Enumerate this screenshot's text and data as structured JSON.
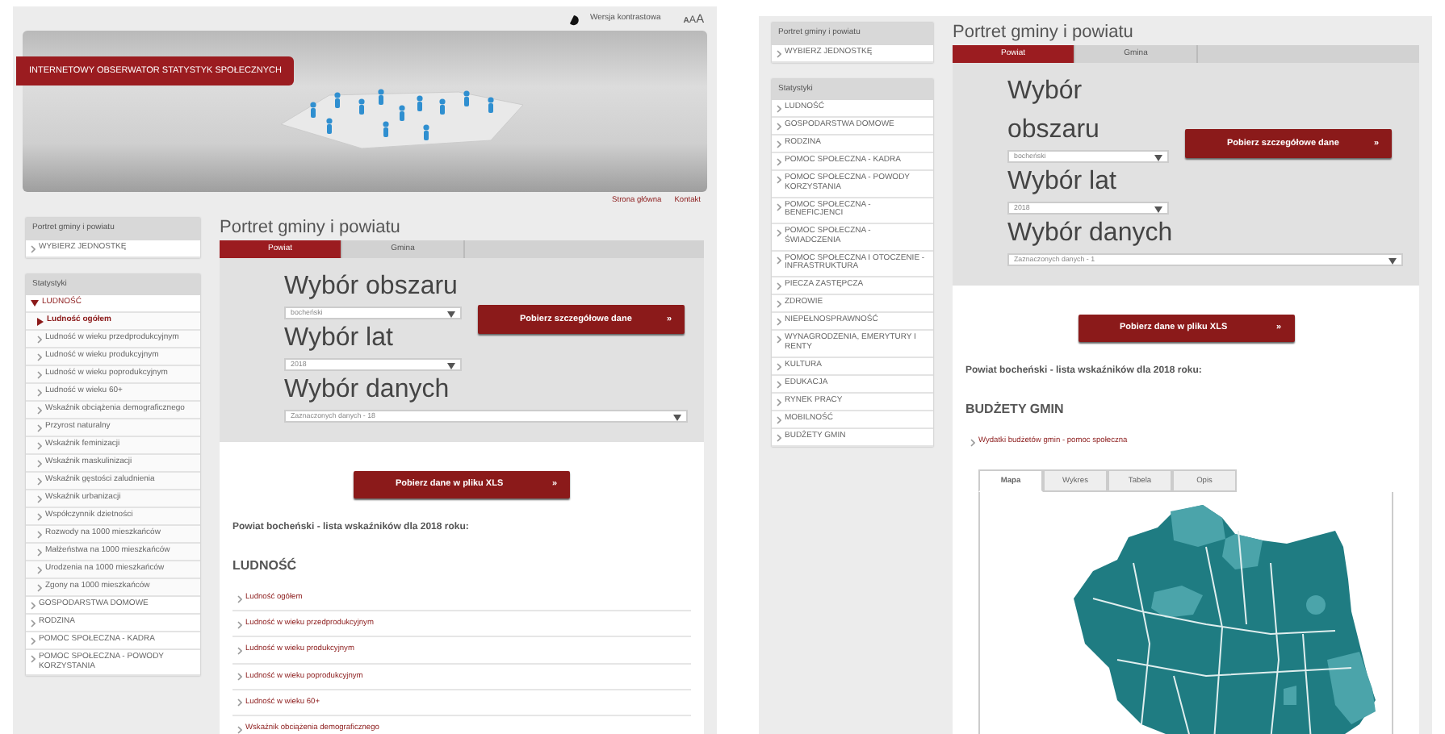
{
  "screens": [
    {
      "top_bar": {
        "contrast_link": "Wersja kontrastowa",
        "font_sizes": [
          "A",
          "A",
          "A"
        ]
      },
      "banner": {
        "title": "INTERNETOWY OBSERWATOR STATYSTYK SPOŁECZNYCH"
      },
      "top_links": [
        "Strona główna",
        "Kontakt"
      ],
      "sidebar": {
        "portrait_title": "Portret gminy i powiatu",
        "choose_unit": "WYBIERZ JEDNOSTKĘ",
        "stats_title": "Statystyki",
        "items": [
          {
            "label": "LUDNOŚĆ",
            "expanded": true,
            "children": [
              {
                "label": "Ludność ogółem",
                "selected": true
              },
              {
                "label": "Ludność w wieku przedprodukcyjnym",
                "selected": false
              },
              {
                "label": "Ludność w wieku produkcyjnym",
                "selected": false
              },
              {
                "label": "Ludność w wieku poprodukcyjnym",
                "selected": false
              },
              {
                "label": "Ludność w wieku 60+",
                "selected": false
              },
              {
                "label": "Wskaźnik obciążenia demograficznego",
                "selected": false
              },
              {
                "label": "Przyrost naturalny",
                "selected": false
              },
              {
                "label": "Wskaźnik feminizacji",
                "selected": false
              },
              {
                "label": "Wskaźnik maskulinizacji",
                "selected": false
              },
              {
                "label": "Wskaźnik gęstości zaludnienia",
                "selected": false
              },
              {
                "label": "Wskaźnik urbanizacji",
                "selected": false
              },
              {
                "label": "Współczynnik dzietności",
                "selected": false
              },
              {
                "label": "Rozwody na 1000 mieszkańców",
                "selected": false
              },
              {
                "label": "Małżeństwa na 1000 mieszkańców",
                "selected": false
              },
              {
                "label": "Urodzenia na 1000 mieszkańców",
                "selected": false
              },
              {
                "label": "Zgony na 1000 mieszkańców",
                "selected": false
              }
            ]
          },
          {
            "label": "GOSPODARSTWA DOMOWE",
            "expanded": false
          },
          {
            "label": "RODZINA",
            "expanded": false
          },
          {
            "label": "POMOC SPOŁECZNA - KADRA",
            "expanded": false
          },
          {
            "label": "POMOC SPOŁECZNA - POWODY KORZYSTANIA",
            "expanded": false
          }
        ]
      },
      "main": {
        "title": "Portret gminy i powiatu",
        "tabs": [
          {
            "label": "Powiat",
            "selected": true
          },
          {
            "label": "Gmina",
            "selected": false
          }
        ],
        "area_label": "Wybór obszaru",
        "area_value": "bocheński",
        "years_label": "Wybór lat",
        "years_value": "2018",
        "data_label": "Wybór danych",
        "data_value": "Zaznaczonych danych - 18",
        "details_button": {
          "label": "Pobierz szczegółowe dane",
          "arrow": "»"
        },
        "xls_button": {
          "label": "Pobierz dane w pliku XLS",
          "arrow": "»"
        },
        "list_heading": "Powiat bocheński - lista wskaźników dla 2018 roku:",
        "section_heading": "LUDNOŚĆ",
        "links": [
          "Ludność ogółem",
          "Ludność w wieku przedprodukcyjnym",
          "Ludność w wieku produkcyjnym",
          "Ludność w wieku poprodukcyjnym",
          "Ludność w wieku 60+",
          "Wskaźnik obciążenia demograficznego"
        ]
      }
    },
    {
      "sidebar": {
        "portrait_title": "Portret gminy i powiatu",
        "choose_unit": "WYBIERZ JEDNOSTKĘ",
        "stats_title": "Statystyki",
        "items": [
          {
            "label": "LUDNOŚĆ",
            "expanded": false
          },
          {
            "label": "GOSPODARSTWA DOMOWE",
            "expanded": false
          },
          {
            "label": "RODZINA",
            "expanded": false
          },
          {
            "label": "POMOC SPOŁECZNA - KADRA",
            "expanded": false
          },
          {
            "label": "POMOC SPOŁECZNA - POWODY KORZYSTANIA",
            "expanded": false
          },
          {
            "label": "POMOC SPOŁECZNA - BENEFICJENCI",
            "expanded": false
          },
          {
            "label": "POMOC SPOŁECZNA - ŚWIADCZENIA",
            "expanded": false
          },
          {
            "label": "POMOC SPOŁECZNA I OTOCZENIE - INFRASTRUKTURA",
            "expanded": false
          },
          {
            "label": "PIECZA ZASTĘPCZA",
            "expanded": false
          },
          {
            "label": "ZDROWIE",
            "expanded": false
          },
          {
            "label": "NIEPEŁNOSPRAWNOŚĆ",
            "expanded": false
          },
          {
            "label": "WYNAGRODZENIA, EMERYTURY I RENTY",
            "expanded": false
          },
          {
            "label": "KULTURA",
            "expanded": false
          },
          {
            "label": "EDUKACJA",
            "expanded": false
          },
          {
            "label": "RYNEK PRACY",
            "expanded": false
          },
          {
            "label": "MOBILNOŚĆ",
            "expanded": false
          },
          {
            "label": "BUDŻETY GMIN",
            "expanded": false
          }
        ]
      },
      "main": {
        "title": "Portret gminy i powiatu",
        "tabs": [
          {
            "label": "Powiat",
            "selected": true
          },
          {
            "label": "Gmina",
            "selected": false
          }
        ],
        "area_label": "Wybór obszaru",
        "area_value": "bocheński",
        "years_label": "Wybór lat",
        "years_value": "2018",
        "data_label": "Wybór danych",
        "data_value": "Zaznaczonych danych - 1",
        "details_button": {
          "label": "Pobierz szczegółowe dane",
          "arrow": "»"
        },
        "xls_button": {
          "label": "Pobierz dane w pliku XLS",
          "arrow": "»"
        },
        "list_heading": "Powiat bocheński - lista wskaźników dla 2018 roku:",
        "section_heading": "BUDŻETY GMIN",
        "links": [
          "Wydatki budżetów gmin - pomoc społeczna"
        ],
        "view_tabs": [
          {
            "label": "Mapa",
            "selected": true
          },
          {
            "label": "Wykres",
            "selected": false
          },
          {
            "label": "Tabela",
            "selected": false
          },
          {
            "label": "Opis",
            "selected": false
          }
        ]
      }
    }
  ]
}
